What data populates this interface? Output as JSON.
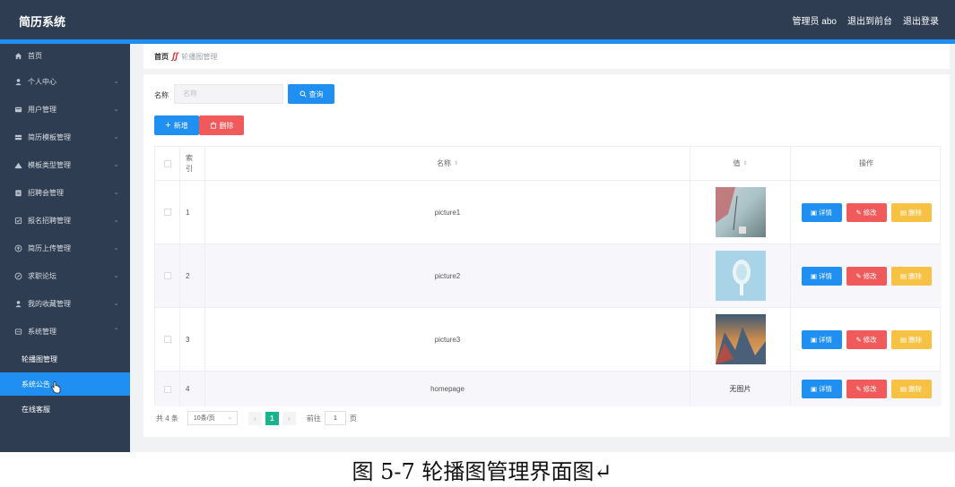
{
  "header": {
    "title": "简历系统",
    "admin": "管理员 abo",
    "exit_backend": "退出到前台",
    "logout": "退出登录"
  },
  "sidebar": {
    "items": [
      {
        "label": "首页",
        "icon": "home-icon",
        "has_children": false
      },
      {
        "label": "个人中心",
        "icon": "user-icon",
        "has_children": true
      },
      {
        "label": "用户管理",
        "icon": "users-icon",
        "has_children": true
      },
      {
        "label": "简历模板管理",
        "icon": "template-icon",
        "has_children": true
      },
      {
        "label": "模板类型管理",
        "icon": "category-icon",
        "has_children": true
      },
      {
        "label": "招聘会管理",
        "icon": "briefcase-icon",
        "has_children": true
      },
      {
        "label": "报名招聘管理",
        "icon": "signup-icon",
        "has_children": true
      },
      {
        "label": "简历上传管理",
        "icon": "upload-icon",
        "has_children": true
      },
      {
        "label": "求职论坛",
        "icon": "forum-icon",
        "has_children": true
      },
      {
        "label": "我的收藏管理",
        "icon": "star-icon",
        "has_children": true
      },
      {
        "label": "系统管理",
        "icon": "system-icon",
        "has_children": true,
        "expanded": true
      }
    ],
    "sub_items": [
      {
        "label": "轮播图管理",
        "active": false
      },
      {
        "label": "系统公告",
        "active": true
      },
      {
        "label": "在线客服",
        "active": false
      }
    ]
  },
  "breadcrumb": {
    "home": "首页",
    "current": "轮播图管理"
  },
  "search": {
    "label": "名称",
    "placeholder": "名称",
    "button": "查询"
  },
  "toolbar": {
    "add": "新增",
    "delete": "删除"
  },
  "table": {
    "headers": {
      "index": "索引",
      "name": "名称",
      "value": "值",
      "ops": "操作"
    },
    "rows": [
      {
        "index": "1",
        "name": "picture1",
        "image": "picture1-thumb",
        "value_text": ""
      },
      {
        "index": "2",
        "name": "picture2",
        "image": "picture2-thumb",
        "value_text": ""
      },
      {
        "index": "3",
        "name": "picture3",
        "image": "picture3-thumb",
        "value_text": ""
      },
      {
        "index": "4",
        "name": "homepage",
        "image": "",
        "value_text": "无图片"
      }
    ],
    "ops": {
      "detail": "详情",
      "edit": "修改",
      "delete": "删除"
    }
  },
  "pagination": {
    "total": "共 4 条",
    "page_size": "10条/页",
    "current_page": "1",
    "goto_label": "前往",
    "goto_value": "1",
    "goto_unit": "页"
  },
  "caption": "图 5-7 轮播图管理界面图↵",
  "colors": {
    "topbar": "#2f3d52",
    "accent": "#1f8ff2",
    "danger": "#f05a5a",
    "warning": "#f7c244",
    "pager_active": "#19b48c"
  }
}
